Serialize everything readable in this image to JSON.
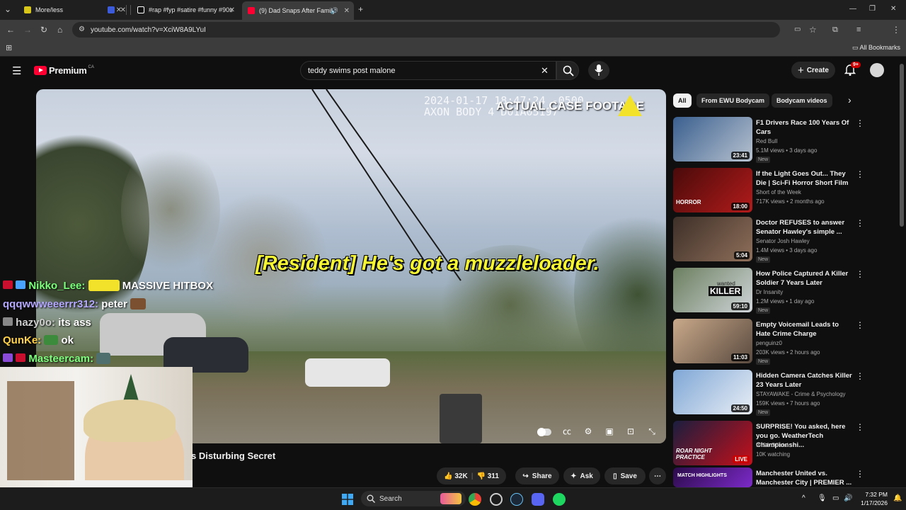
{
  "browser": {
    "tabs": [
      {
        "title": "More/less",
        "favicon_color": "#d8c61a"
      },
      {
        "title": "",
        "favicon_color": "#3b5bdb"
      },
      {
        "title": "#rap #fyp #satire #funny #90s",
        "favicon_color": "#ffffff"
      },
      {
        "title": "(9) Dad Snaps After Family",
        "favicon_color": "#ff0033",
        "active": true
      }
    ],
    "url": "youtube.com/watch?v=XciW8A9LYuI",
    "all_bookmarks": "All Bookmarks"
  },
  "youtube": {
    "logo_text": "Premium",
    "region": "CA",
    "search_value": "teddy swims post malone",
    "create_label": "Create",
    "notif_count": "9+"
  },
  "player": {
    "bodycam_stamp": "2024-01-17 18:47:24 -0500\nAXON BODY 4 D01A05197",
    "banner": "ACTUAL CASE FOOTAGE",
    "caption": "[Resident] He's got a muzzleloader."
  },
  "video": {
    "title_fragment": "s Disturbing Secret",
    "likes": "32K",
    "dislikes": "311",
    "share": "Share",
    "ask": "Ask",
    "save": "Save"
  },
  "chat": [
    {
      "user": "Nikko_Lee:",
      "msg": "MASSIVE HITBOX",
      "color": "#79ff79"
    },
    {
      "user": "qqqwwweeerrr312:",
      "msg": "peter",
      "color": "#b4a8ff"
    },
    {
      "user": "hazy0o:",
      "msg": "its ass",
      "color": "#cfcfcf"
    },
    {
      "user": "QunKe:",
      "msg": "ok",
      "color": "#ffd24a"
    },
    {
      "user": "Masteercam:",
      "msg": "",
      "color": "#7dff7d"
    }
  ],
  "chips": [
    "All",
    "From EWU Bodycam",
    "Bodycam videos"
  ],
  "recommendations": [
    {
      "title": "F1 Drivers Race 100 Years Of Cars",
      "channel": "Red Bull",
      "meta": "5.1M views • 3 days ago",
      "badge": "New",
      "duration": "23:41",
      "thumb": [
        "#3a5f8f",
        "#b7c2cf"
      ]
    },
    {
      "title": "If the Light Goes Out... They Die | Sci-Fi Horror Short Film",
      "channel": "Short of the Week",
      "meta": "717K views • 2 months ago",
      "badge": "",
      "duration": "18:00",
      "thumb": [
        "#4a0a0a",
        "#b21b1b"
      ]
    },
    {
      "title": "Doctor REFUSES to answer Senator Hawley's simple ...",
      "channel": "Senator Josh Hawley",
      "meta": "1.4M views • 3 days ago",
      "badge": "New",
      "duration": "5:04",
      "thumb": [
        "#3d2f28",
        "#8f6f5a"
      ]
    },
    {
      "title": "How Police Captured A Killer Soldier 7 Years Later",
      "channel": "Dr Insanity",
      "meta": "1.2M views • 1 day ago",
      "badge": "New",
      "duration": "59:10",
      "thumb": [
        "#6b7f5f",
        "#cfd4d8"
      ]
    },
    {
      "title": "Empty Voicemail Leads to Hate Crime Charge",
      "channel": "penguinz0",
      "meta": "203K views • 2 hours ago",
      "badge": "New",
      "duration": "11:03",
      "thumb": [
        "#c9a98a",
        "#5a4a3f"
      ]
    },
    {
      "title": "Hidden Camera Catches Killer 23 Years Later",
      "channel": "STAYAWAKE - Crime & Psychology",
      "meta": "159K views • 7 hours ago",
      "badge": "New",
      "duration": "24:50",
      "thumb": [
        "#7fa7d6",
        "#e9eef5"
      ]
    },
    {
      "title": "SURPRISE! You asked, here you go. WeatherTech Championshi...",
      "channel": "IMSA Official",
      "meta": "10K watching",
      "badge": "",
      "duration": "LIVE",
      "thumb": [
        "#1a1e3f",
        "#c4101a"
      ]
    },
    {
      "title": "Manchester United vs. Manchester City | PREMIER ...",
      "channel": "",
      "meta": "",
      "badge": "",
      "duration": "",
      "thumb": [
        "#2b0b4a",
        "#7c2ac9"
      ]
    }
  ],
  "thumb_overlays": {
    "horror": "HORROR",
    "wanted": "wanted",
    "killer": "KILLER",
    "roar": "ROAR NIGHT PRACTICE",
    "match": "MATCH HIGHLIGHTS"
  },
  "taskbar": {
    "search": "Search",
    "time": "7:32 PM",
    "date": "1/17/2026"
  }
}
